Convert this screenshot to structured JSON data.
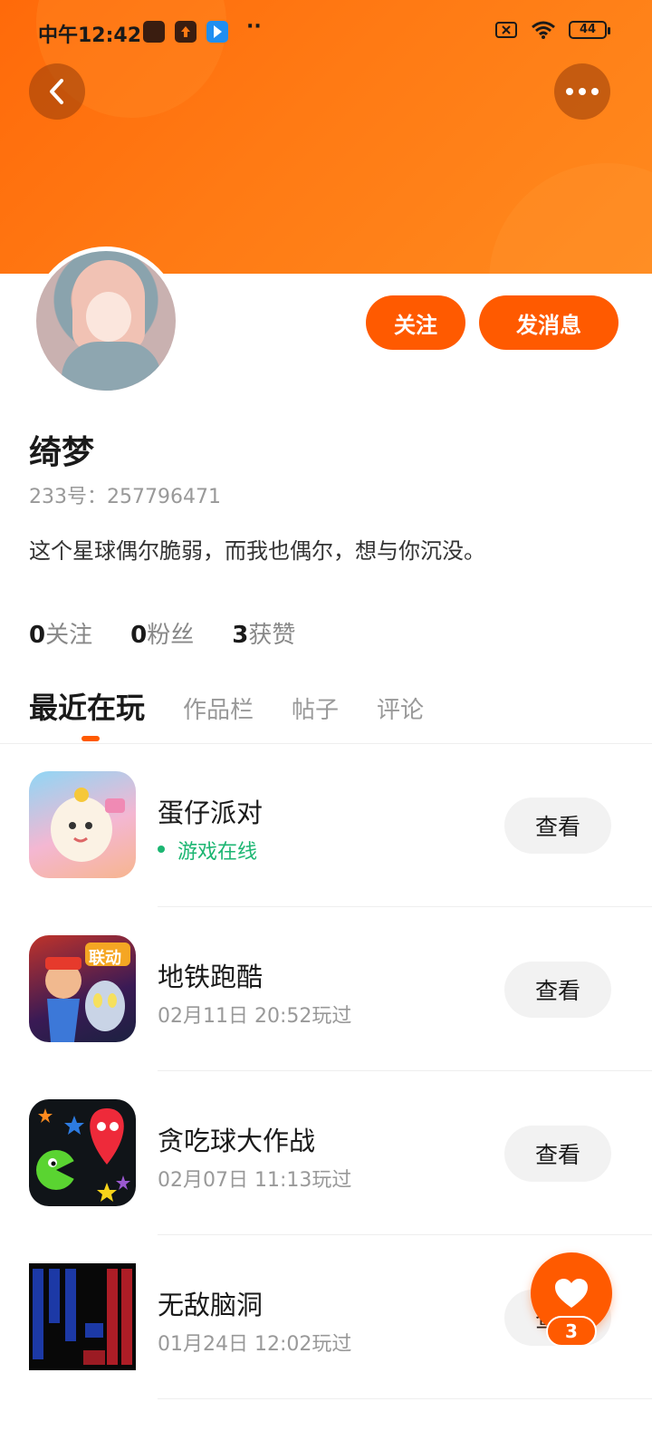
{
  "status_bar": {
    "time": "中午12:42",
    "battery": "44",
    "dots": "··"
  },
  "profile": {
    "name": "绮梦",
    "uid": "233号：257796471",
    "bio": "这个星球偶尔脆弱，而我也偶尔，想与你沉没。",
    "follow_button": "关注",
    "message_button": "发消息"
  },
  "stats": [
    {
      "value": "0",
      "label": "关注"
    },
    {
      "value": "0",
      "label": "粉丝"
    },
    {
      "value": "3",
      "label": "获赞"
    }
  ],
  "tabs": [
    {
      "label": "最近在玩",
      "active": true
    },
    {
      "label": "作品栏",
      "active": false
    },
    {
      "label": "帖子",
      "active": false
    },
    {
      "label": "评论",
      "active": false
    }
  ],
  "games": [
    {
      "title": "蛋仔派对",
      "subtitle": "游戏在线",
      "online": true,
      "button": "查看",
      "icon": "egg-party-icon"
    },
    {
      "title": "地铁跑酷",
      "subtitle": "02月11日 20:52玩过",
      "online": false,
      "button": "查看",
      "icon": "subway-surfers-icon",
      "icon_badge": "联动"
    },
    {
      "title": "贪吃球大作战",
      "subtitle": "02月07日 11:13玩过",
      "online": false,
      "button": "查看",
      "icon": "agar-battle-icon"
    },
    {
      "title": "无敌脑洞",
      "subtitle": "01月24日 12:02玩过",
      "online": false,
      "button": "查看",
      "icon": "brain-hole-icon"
    }
  ],
  "fab": {
    "like_count": "3"
  },
  "colors": {
    "accent": "#ff5a00",
    "online": "#1cb672"
  }
}
